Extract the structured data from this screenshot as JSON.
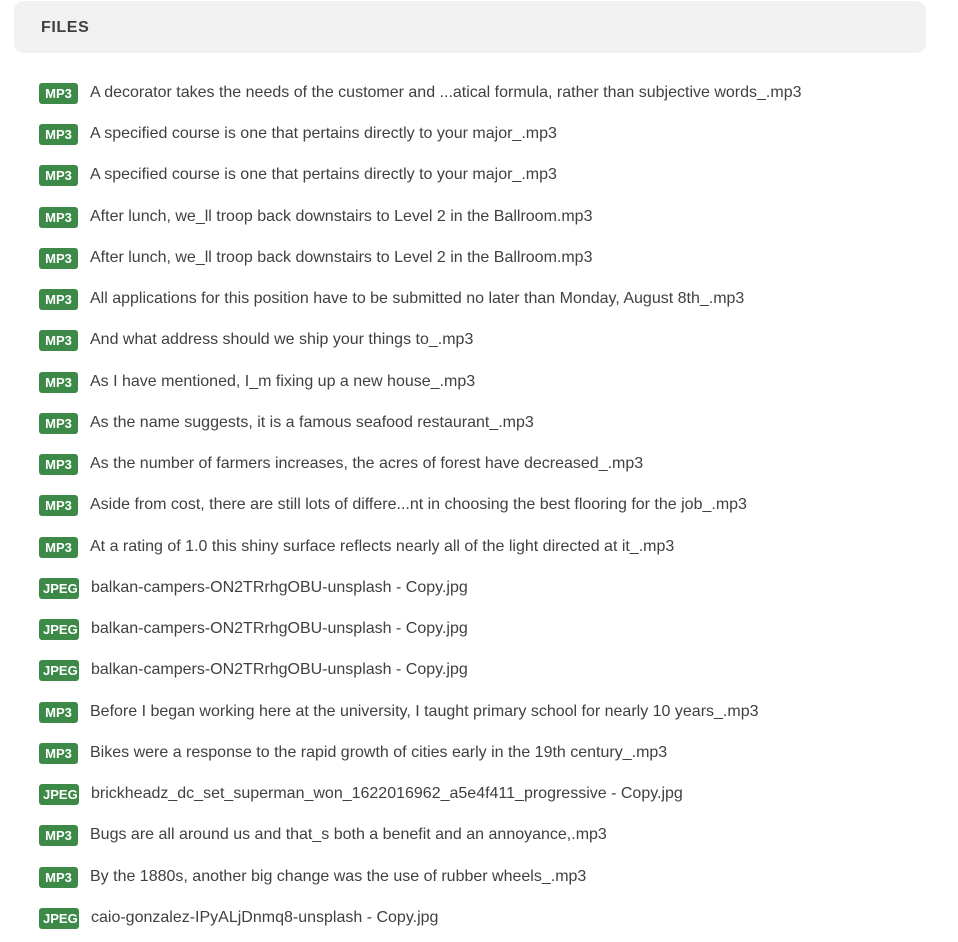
{
  "header": {
    "title": "FILES"
  },
  "colors": {
    "badge_bg": "#3d8a48",
    "header_bg": "#f1f1f1",
    "text": "#404040"
  },
  "files": [
    {
      "type": "MP3",
      "name": "A decorator takes the needs of the customer and ...atical formula, rather than subjective words_.mp3"
    },
    {
      "type": "MP3",
      "name": "A specified course is one that pertains directly to your major_.mp3"
    },
    {
      "type": "MP3",
      "name": "A specified course is one that pertains directly to your major_.mp3"
    },
    {
      "type": "MP3",
      "name": "After lunch, we_ll troop back downstairs to Level 2 in the Ballroom.mp3"
    },
    {
      "type": "MP3",
      "name": "After lunch, we_ll troop back downstairs to Level 2 in the Ballroom.mp3"
    },
    {
      "type": "MP3",
      "name": "All applications for this position have to be submitted no later than Monday, August 8th_.mp3"
    },
    {
      "type": "MP3",
      "name": "And what address should we ship your things to_.mp3"
    },
    {
      "type": "MP3",
      "name": "As I have mentioned, I_m fixing up a new house_.mp3"
    },
    {
      "type": "MP3",
      "name": "As the name suggests, it is a famous seafood restaurant_.mp3"
    },
    {
      "type": "MP3",
      "name": "As the number of farmers increases, the acres of forest have decreased_.mp3"
    },
    {
      "type": "MP3",
      "name": "Aside from cost, there are still lots of differe...nt in choosing the best flooring for the job_.mp3"
    },
    {
      "type": "MP3",
      "name": "At a rating of 1.0 this shiny surface reflects nearly all of the light directed at it_.mp3"
    },
    {
      "type": "JPEG",
      "name": "balkan-campers-ON2TRrhgOBU-unsplash - Copy.jpg"
    },
    {
      "type": "JPEG",
      "name": "balkan-campers-ON2TRrhgOBU-unsplash - Copy.jpg"
    },
    {
      "type": "JPEG",
      "name": "balkan-campers-ON2TRrhgOBU-unsplash - Copy.jpg"
    },
    {
      "type": "MP3",
      "name": "Before I began working here at the university, I taught primary school for nearly 10 years_.mp3"
    },
    {
      "type": "MP3",
      "name": "Bikes were a response to the rapid growth of cities early in the 19th century_.mp3"
    },
    {
      "type": "JPEG",
      "name": "brickheadz_dc_set_superman_won_1622016962_a5e4f411_progressive - Copy.jpg"
    },
    {
      "type": "MP3",
      "name": "Bugs are all around us and that_s both a benefit and an annoyance,.mp3"
    },
    {
      "type": "MP3",
      "name": "By the 1880s, another big change was the use of rubber wheels_.mp3"
    },
    {
      "type": "JPEG",
      "name": "caio-gonzalez-IPyALjDnmq8-unsplash - Copy.jpg"
    }
  ]
}
